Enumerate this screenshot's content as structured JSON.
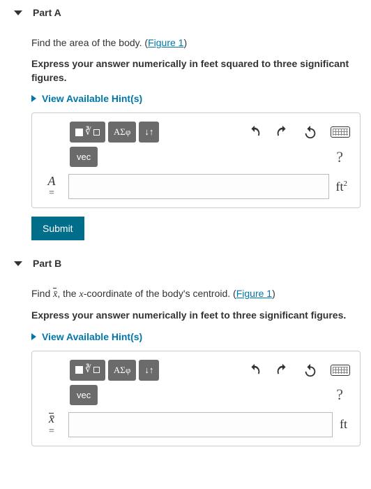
{
  "partA": {
    "title": "Part A",
    "question_prefix": "Find the area of the body. (",
    "figure_link": "Figure 1",
    "question_suffix": ")",
    "instruction": "Express your answer numerically in feet squared to three significant figures.",
    "hints_label": "View Available Hint(s)",
    "toolbar": {
      "greek_label": "ΑΣφ",
      "arrows_label": "↓↑",
      "vec_label": "vec",
      "help_label": "?"
    },
    "variable": "A",
    "equals": "=",
    "unit_html": "ft²",
    "input_value": "",
    "submit_label": "Submit"
  },
  "partB": {
    "title": "Part B",
    "question_prefix": "Find ",
    "variable_inline": "x̄",
    "question_mid": ", the ",
    "coord_var": "x",
    "question_mid2": "-coordinate of the body's centroid. (",
    "figure_link": "Figure 1",
    "question_suffix": ")",
    "instruction": "Express your answer numerically in feet to three significant figures.",
    "hints_label": "View Available Hint(s)",
    "toolbar": {
      "greek_label": "ΑΣφ",
      "arrows_label": "↓↑",
      "vec_label": "vec",
      "help_label": "?"
    },
    "variable": "x̄",
    "equals": "=",
    "unit_html": "ft",
    "input_value": ""
  }
}
